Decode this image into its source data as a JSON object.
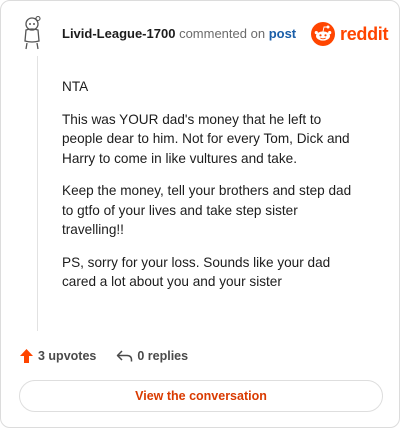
{
  "comment": {
    "username": "Livid-League-1700",
    "commented_on": "commented on",
    "post_link": "post",
    "paragraphs": [
      "NTA",
      "This was YOUR dad's money that he left to people dear to him. Not for every Tom, Dick and Harry to come in like vultures and take.",
      "Keep the money, tell your brothers and step dad to gtfo of your lives and take step sister travelling!!",
      "PS, sorry for your loss. Sounds like your dad cared a lot about you and your sister"
    ]
  },
  "brand": {
    "name": "reddit",
    "color": "#ff4500",
    "icon": "reddit-snoo-icon"
  },
  "actions": {
    "upvotes_label": "3 upvotes",
    "upvote_icon": "upvote-arrow-icon",
    "upvote_color": "#ff4500",
    "replies_label": "0 replies",
    "reply_icon": "reply-arrow-icon"
  },
  "cta": {
    "label": "View the conversation",
    "color": "#d93a00"
  },
  "avatar": {
    "icon": "snoo-avatar-icon"
  }
}
